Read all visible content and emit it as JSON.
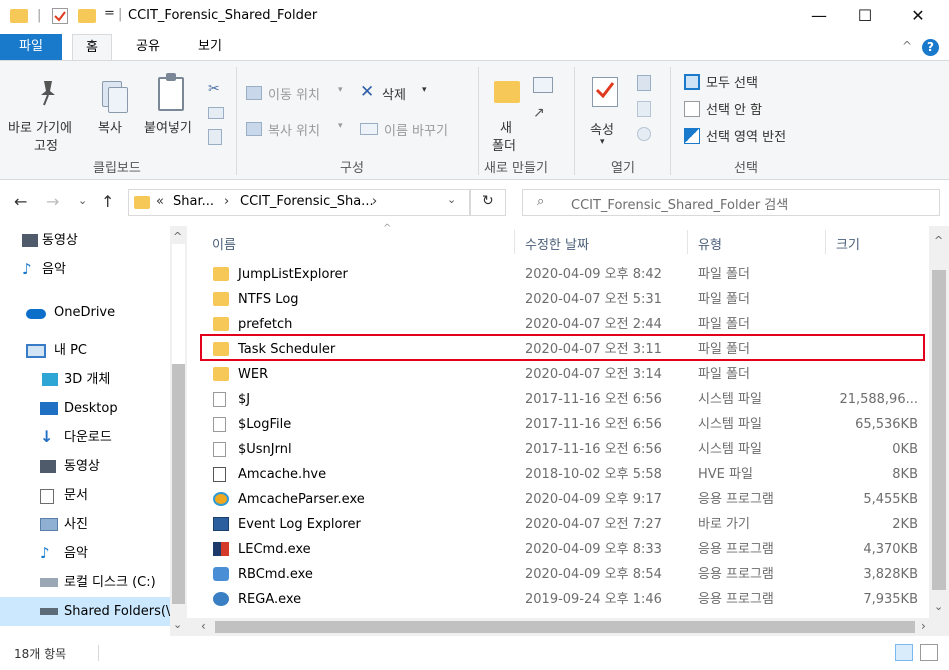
{
  "window": {
    "title": "CCIT_Forensic_Shared_Folder",
    "quick_access_sep": "| ",
    "dropdown_glyph": "=",
    "title_sep": "|",
    "minimize": "—",
    "maximize": "☐",
    "close": "✕"
  },
  "menu": {
    "tabs": [
      "파일",
      "홈",
      "공유",
      "보기"
    ],
    "collapse_glyph": "^",
    "help_glyph": "?"
  },
  "ribbon": {
    "clipboard": {
      "pin_line1": "바로 가기에",
      "pin_line2": "고정",
      "copy": "복사",
      "paste": "붙여넣기",
      "group": "클립보드"
    },
    "organize": {
      "move_to": "이동 위치",
      "delete": "삭제",
      "copy_to": "복사 위치",
      "rename": "이름 바꾸기",
      "group": "구성"
    },
    "new": {
      "new_folder_line1": "새",
      "new_folder_line2": "폴더",
      "group": "새로 만들기"
    },
    "open": {
      "properties": "속성",
      "group": "열기"
    },
    "select": {
      "select_all": "모두 선택",
      "select_none": "선택 안 함",
      "invert": "선택 영역 반전",
      "group": "선택"
    }
  },
  "address": {
    "path_prefix": "«",
    "crumb1": "Shar...",
    "crumb2": "CCIT_Forensic_Sha...",
    "search_placeholder": "CCIT_Forensic_Shared_Folder 검색"
  },
  "nav": {
    "items": [
      {
        "label": "동영상",
        "icon": "video-icon"
      },
      {
        "label": "음악",
        "icon": "music-icon"
      },
      {
        "label": "OneDrive",
        "icon": "cloud-icon"
      },
      {
        "label": "내 PC",
        "icon": "pc-icon"
      },
      {
        "label": "3D 개체",
        "icon": "3d-objects-icon"
      },
      {
        "label": "Desktop",
        "icon": "desktop-icon"
      },
      {
        "label": "다운로드",
        "icon": "download-icon"
      },
      {
        "label": "동영상",
        "icon": "video-icon"
      },
      {
        "label": "문서",
        "icon": "documents-icon"
      },
      {
        "label": "사진",
        "icon": "pictures-icon"
      },
      {
        "label": "음악",
        "icon": "music-icon"
      },
      {
        "label": "로컬 디스크 (C:)",
        "icon": "local-disk-icon"
      },
      {
        "label": "Shared Folders(\\\\",
        "icon": "network-drive-icon"
      }
    ]
  },
  "list": {
    "columns": {
      "name": "이름",
      "date": "수정한 날짜",
      "type": "유형",
      "size": "크기"
    },
    "rows": [
      {
        "name": "JumpListExplorer",
        "date": "2020-04-09 오후 8:42",
        "type": "파일 폴더",
        "size": "",
        "icon": "folder-icon"
      },
      {
        "name": "NTFS Log",
        "date": "2020-04-07 오전 5:31",
        "type": "파일 폴더",
        "size": "",
        "icon": "folder-icon"
      },
      {
        "name": "prefetch",
        "date": "2020-04-07 오전 2:44",
        "type": "파일 폴더",
        "size": "",
        "icon": "folder-icon"
      },
      {
        "name": "Task Scheduler",
        "date": "2020-04-07 오전 3:11",
        "type": "파일 폴더",
        "size": "",
        "icon": "folder-icon"
      },
      {
        "name": "WER",
        "date": "2020-04-07 오전 3:14",
        "type": "파일 폴더",
        "size": "",
        "icon": "folder-icon"
      },
      {
        "name": "$J",
        "date": "2017-11-16 오전 6:56",
        "type": "시스템 파일",
        "size": "21,588,96...",
        "icon": "system-file-icon"
      },
      {
        "name": "$LogFile",
        "date": "2017-11-16 오전 6:56",
        "type": "시스템 파일",
        "size": "65,536KB",
        "icon": "system-file-icon"
      },
      {
        "name": "$UsnJrnl",
        "date": "2017-11-16 오전 6:56",
        "type": "시스템 파일",
        "size": "0KB",
        "icon": "system-file-icon"
      },
      {
        "name": "Amcache.hve",
        "date": "2018-10-02 오후 5:58",
        "type": "HVE 파일",
        "size": "8KB",
        "icon": "file-icon"
      },
      {
        "name": "AmcacheParser.exe",
        "date": "2020-04-09 오후 9:17",
        "type": "응용 프로그램",
        "size": "5,455KB",
        "icon": "app-icon"
      },
      {
        "name": "Event Log Explorer",
        "date": "2020-04-07 오전 7:27",
        "type": "바로 가기",
        "size": "2KB",
        "icon": "shortcut-icon"
      },
      {
        "name": "LECmd.exe",
        "date": "2020-04-09 오후 8:33",
        "type": "응용 프로그램",
        "size": "4,370KB",
        "icon": "app-icon"
      },
      {
        "name": "RBCmd.exe",
        "date": "2020-04-09 오후 8:54",
        "type": "응용 프로그램",
        "size": "3,828KB",
        "icon": "app-icon"
      },
      {
        "name": "REGA.exe",
        "date": "2019-09-24 오후 1:46",
        "type": "응용 프로그램",
        "size": "7,935KB",
        "icon": "app-icon"
      }
    ],
    "highlighted_row": "Task Scheduler"
  },
  "status": {
    "item_count": "18개 항목"
  },
  "colors": {
    "accent": "#1979ca",
    "folder": "#f6c857",
    "highlight_border": "#e2001a",
    "column_header": "#4c607a"
  }
}
